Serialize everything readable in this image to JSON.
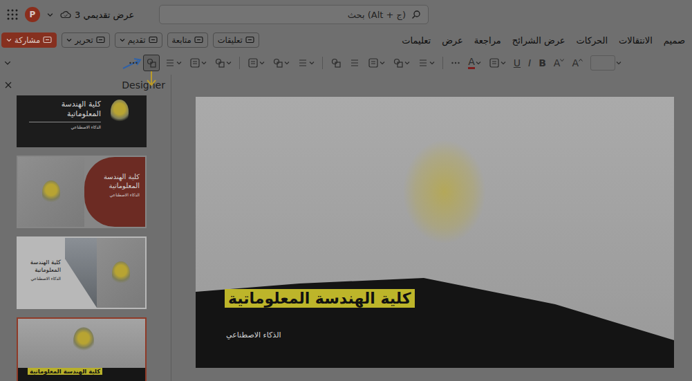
{
  "title_bar": {
    "logo": "P",
    "document_title": "عرض تقديمي 3",
    "search_placeholder": "بحث (Alt + ج)"
  },
  "actions": [
    {
      "label": "مشاركة",
      "kind": "primary",
      "dropdown": true
    },
    {
      "label": "تحرير",
      "kind": "outline",
      "dropdown": true
    },
    {
      "label": "تقديم",
      "kind": "outline",
      "dropdown": true
    },
    {
      "label": "متابعة",
      "kind": "outline",
      "dropdown": false
    },
    {
      "label": "تعليقات",
      "kind": "outline",
      "dropdown": false
    }
  ],
  "ribbon_tabs": [
    {
      "label": "صميم",
      "selected": false
    },
    {
      "label": "الانتقالات",
      "selected": false
    },
    {
      "label": "الحركات",
      "selected": false
    },
    {
      "label": "عرض الشرائح",
      "selected": false
    },
    {
      "label": "مراجعة",
      "selected": false
    },
    {
      "label": "عرض",
      "selected": false
    },
    {
      "label": "تعليمات",
      "selected": false
    }
  ],
  "toolbar": [
    {
      "kind": "field",
      "dropdown": true,
      "selected": false
    },
    {
      "kind": "grow-font",
      "label": "A",
      "dropdown": false,
      "selected": false
    },
    {
      "kind": "shrink-font",
      "label": "A",
      "dropdown": false,
      "selected": false
    },
    {
      "kind": "bold",
      "label": "B",
      "dropdown": false,
      "selected": false
    },
    {
      "kind": "italic",
      "label": "I",
      "dropdown": false,
      "selected": false
    },
    {
      "kind": "underline",
      "label": "U",
      "dropdown": false,
      "selected": false
    },
    {
      "kind": "icon",
      "dropdown": true,
      "selected": false
    },
    {
      "kind": "font-color",
      "label": "A",
      "dropdown": true,
      "selected": false
    },
    {
      "kind": "more",
      "dropdown": false,
      "selected": false
    },
    {
      "kind": "separator",
      "dropdown": false,
      "selected": false
    },
    {
      "kind": "icon",
      "dropdown": true,
      "selected": false
    },
    {
      "kind": "icon",
      "dropdown": true,
      "selected": false
    },
    {
      "kind": "icon",
      "dropdown": true,
      "selected": false
    },
    {
      "kind": "icon",
      "dropdown": false,
      "selected": false
    },
    {
      "kind": "icon",
      "dropdown": false,
      "selected": false
    },
    {
      "kind": "separator",
      "dropdown": false,
      "selected": false
    },
    {
      "kind": "icon",
      "dropdown": true,
      "selected": false
    },
    {
      "kind": "icon",
      "dropdown": true,
      "selected": false
    },
    {
      "kind": "icon",
      "dropdown": true,
      "selected": false
    },
    {
      "kind": "separator",
      "dropdown": false,
      "selected": false
    },
    {
      "kind": "icon",
      "dropdown": true,
      "selected": false
    },
    {
      "kind": "icon",
      "dropdown": true,
      "selected": false
    },
    {
      "kind": "icon",
      "dropdown": true,
      "selected": false
    },
    {
      "kind": "icon",
      "dropdown": false,
      "selected": true
    },
    {
      "kind": "more",
      "dropdown": false,
      "selected": false
    }
  ],
  "designer": {
    "title": "Designer",
    "thumbnails": [
      {
        "kind": "dark",
        "title": "كلية الهندسة المعلوماتية",
        "subtitle": "الذكاء الاصطناعي",
        "selected": false
      },
      {
        "kind": "split-red",
        "title": "كلية الهندسة المعلوماتية",
        "subtitle": "الذكاء الاصطناعي",
        "selected": false
      },
      {
        "kind": "split-light",
        "title": "كلية الهندسة المعلوماتية",
        "subtitle": "الذكاء الاصطناعي",
        "selected": false
      },
      {
        "kind": "photo",
        "title": "كلية الهندسة المعلوماتية",
        "selected": true
      }
    ]
  },
  "slide": {
    "title": "كلية الهندسة المعلوماتية",
    "subtitle": "الذكاء الاصطناعي"
  }
}
